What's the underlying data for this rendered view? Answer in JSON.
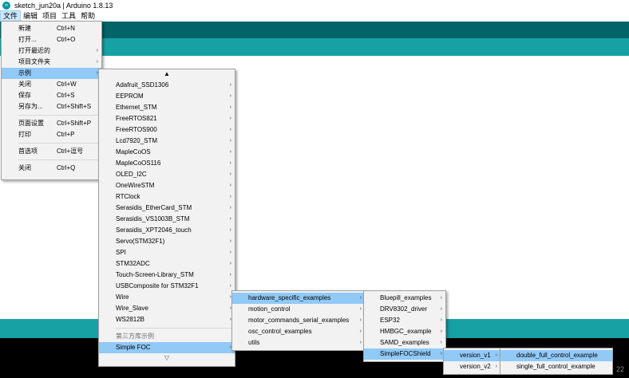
{
  "window": {
    "title": "sketch_jun20a | Arduino 1.8.13",
    "icon": "arduino-icon"
  },
  "menubar": [
    "文件",
    "编辑",
    "项目",
    "工具",
    "帮助"
  ],
  "file_menu": {
    "items": [
      {
        "label": "新建",
        "shortcut": "Ctrl+N"
      },
      {
        "label": "打开...",
        "shortcut": "Ctrl+O"
      },
      {
        "label": "打开最近的",
        "submenu": true
      },
      {
        "label": "项目文件夹",
        "submenu": true
      },
      {
        "label": "示例",
        "submenu": true,
        "highlighted": true
      },
      {
        "label": "关闭",
        "shortcut": "Ctrl+W"
      },
      {
        "label": "保存",
        "shortcut": "Ctrl+S"
      },
      {
        "label": "另存为...",
        "shortcut": "Ctrl+Shift+S"
      },
      {
        "label": "页面设置",
        "shortcut": "Ctrl+Shift+P"
      },
      {
        "label": "打印",
        "shortcut": "Ctrl+P"
      },
      {
        "label": "首选项",
        "shortcut": "Ctrl+逗号"
      },
      {
        "label": "关闭",
        "shortcut": "Ctrl+Q"
      }
    ]
  },
  "examples_menu": {
    "scroll_up": "▲",
    "scroll_down": "▽",
    "items": [
      "Adafruit_SSD1306",
      "EEPROM",
      "Ethernet_STM",
      "FreeRTOS821",
      "FreeRTOS900",
      "Lcd7920_STM",
      "MapleCoOS",
      "MapleCoOS116",
      "OLED_I2C",
      "OneWireSTM",
      "RTClock",
      "Serasidis_EtherCard_STM",
      "Serasidis_VS1003B_STM",
      "Serasidis_XPT2046_touch",
      "Servo(STM32F1)",
      "SPI",
      "STM32ADC",
      "Touch-Screen-Library_STM",
      "USBComposite for STM32F1",
      "Wire",
      "Wire_Slave",
      "WS2812B"
    ],
    "section_header": "第三方库示例",
    "selected": "Simple FOC"
  },
  "simplefoc_menu": [
    "hardware_specific_examples",
    "motion_control",
    "motor_commands_serial_examples",
    "osc_control_examples",
    "utils"
  ],
  "hardware_menu": [
    "Bluepill_examples",
    "DRV8302_driver",
    "ESP32",
    "HMBGC_example",
    "SAMD_examples",
    "SimpleFOCShield"
  ],
  "shield_menu": [
    "version_v1",
    "version_v2"
  ],
  "version_menu": [
    "double_full_control_example",
    "single_full_control_example"
  ],
  "watermark": "22",
  "colors": {
    "toolbar": "#006468",
    "tabbar": "#17a1a5",
    "highlight": "#91c9f7"
  }
}
